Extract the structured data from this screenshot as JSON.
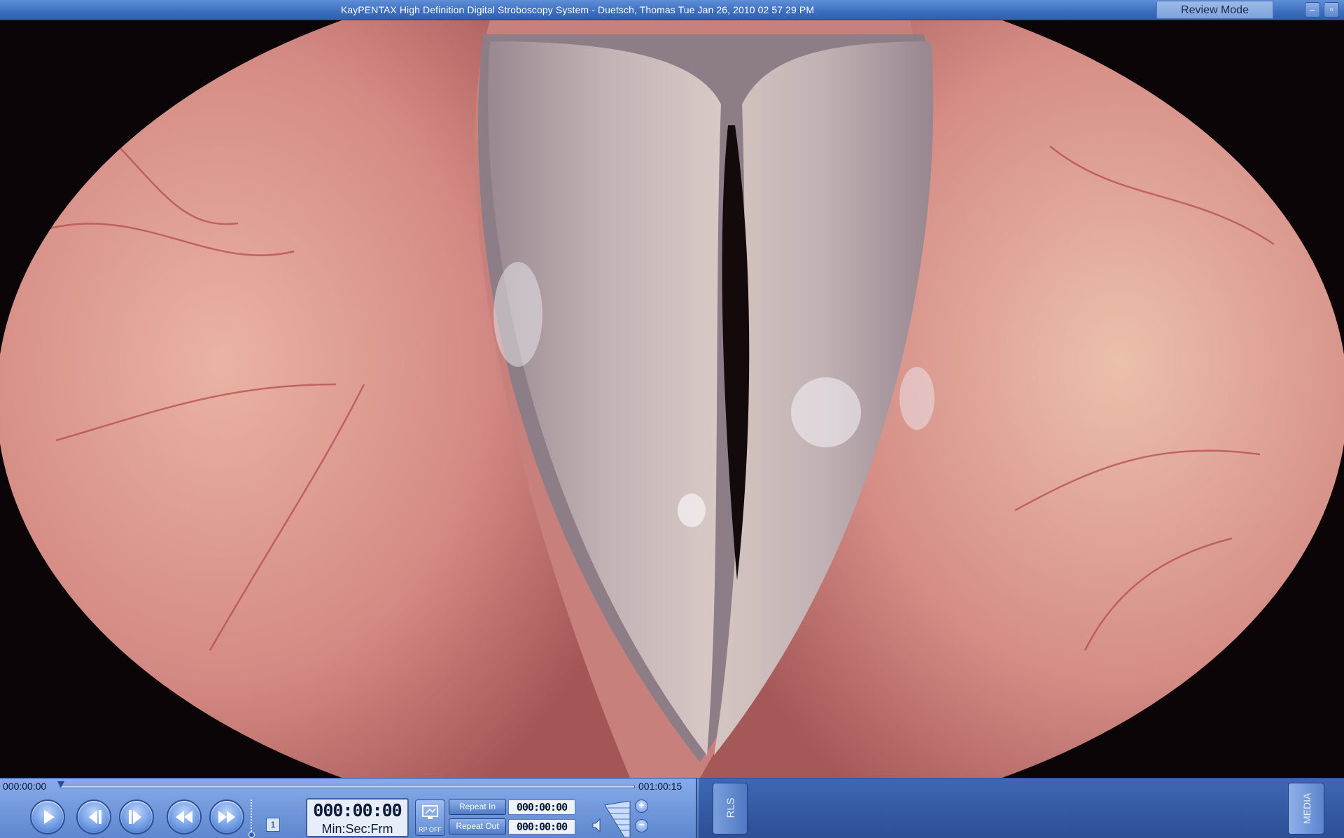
{
  "window": {
    "title": "KayPENTAX High Definition Digital Stroboscopy System - Duetsch, Thomas  Tue Jan 26, 2010 02 57 29 PM",
    "mode": "Review Mode",
    "minimize_glyph": "–",
    "maximize_glyph": "▫"
  },
  "playback": {
    "time_start": "000:00:00",
    "time_end": "001:00:15",
    "position_fraction": 0.0,
    "speed_level": "1",
    "counter_value": "000:00:00",
    "counter_label": "Min:Sec:Frm",
    "rp_off_label": "RP OFF",
    "repeat_in_label": "Repeat In",
    "repeat_out_label": "Repeat Out",
    "repeat_in_time": "000:00:00",
    "repeat_out_time": "000:00:00",
    "volume_up_glyph": "+",
    "volume_down_glyph": "−"
  },
  "side_buttons": {
    "rls_label": "RLS",
    "media_label": "MEDIA"
  },
  "icons": {
    "play": "play-icon",
    "step_back": "step-back-icon",
    "step_forward": "step-forward-icon",
    "rewind": "rewind-icon",
    "fast_forward": "fast-forward-icon",
    "volume": "speaker-icon",
    "rp_off": "monitor-icon"
  },
  "colors": {
    "titlebar": "#3f70c0",
    "panel": "#5e88cf",
    "tissue": "#d9908a",
    "vocal_fold": "#b9a9ad"
  }
}
